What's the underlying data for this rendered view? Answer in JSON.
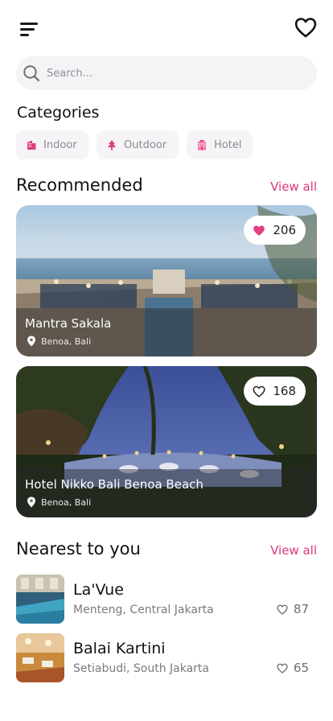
{
  "header": {
    "menu_icon": "menu-icon",
    "favorites_icon": "heart-outline-icon"
  },
  "search": {
    "placeholder": "Search..."
  },
  "categories": {
    "title": "Categories",
    "items": [
      {
        "label": "Indoor",
        "icon": "building-icon"
      },
      {
        "label": "Outdoor",
        "icon": "tree-icon"
      },
      {
        "label": "Hotel",
        "icon": "hotel-icon"
      }
    ]
  },
  "recommended": {
    "title": "Recommended",
    "view_all": "View all",
    "cards": [
      {
        "name": "Mantra Sakala",
        "location": "Benoa, Bali",
        "likes": "206",
        "liked": true
      },
      {
        "name": "Hotel Nikko Bali Benoa Beach",
        "location": "Benoa, Bali",
        "likes": "168",
        "liked": false
      }
    ]
  },
  "nearest": {
    "title": "Nearest to you",
    "view_all": "View all",
    "items": [
      {
        "name": "La'Vue",
        "address": "Menteng, Central Jakarta",
        "likes": "87"
      },
      {
        "name": "Balai Kartini",
        "address": "Setiabudi, South Jakarta",
        "likes": "65"
      }
    ]
  },
  "colors": {
    "accent": "#d9387f",
    "chip_bg": "#f6f4f6",
    "search_bg": "#f4f4f6"
  }
}
